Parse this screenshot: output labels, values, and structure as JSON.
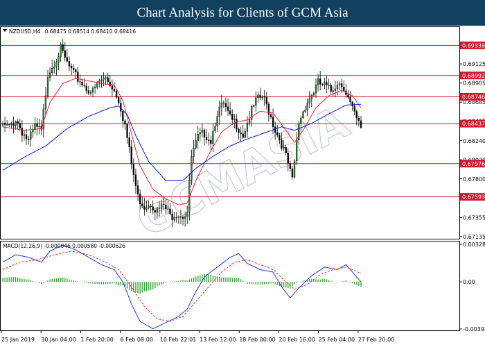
{
  "title": "Chart Analysis for Clients of GCM Asia",
  "price_header": {
    "symbol": "NZDUSD,H4",
    "ohlc": "0.68475 0.68514 0.68410 0.68416"
  },
  "macd_header": "MACD(12,26,9) -0.000046 0.000580 -0.000626",
  "watermark": "GCMASIA",
  "colors": {
    "title_bg": "#12415f",
    "bull": "#2e8b2e",
    "bear": "#000000",
    "ma_fast": "#e8283a",
    "ma_slow": "#1010ee",
    "level": "#cc1a2e",
    "level_label_bg": "#cc1a2e",
    "macd_line": "#1f3bdd",
    "signal_line": "#e0302f",
    "histogram": "#3aa53a"
  },
  "chart_data": [
    {
      "type": "candlestick",
      "symbol": "NZDUSD",
      "timeframe": "H4",
      "ylim": [
        0.6711,
        0.6955
      ],
      "y_ticks": [
        "0.69125",
        "0.68905",
        "0.68685",
        "0.68465",
        "0.68240",
        "0.68020",
        "0.67800",
        "0.67575",
        "0.67355",
        "0.67135"
      ],
      "x_tick_labels": [
        "25 Jan 2019",
        "30 Jan 04:00",
        "1 Feb 20:00",
        "6 Feb 08:00",
        "10 Feb 22:01",
        "13 Feb 12:00",
        "18 Feb 00:00",
        "20 Feb 16:00",
        "25 Feb 04:00",
        "27 Feb 20:00"
      ],
      "levels": [
        {
          "value": 0.69339,
          "label": "0.69339"
        },
        {
          "value": 0.68992,
          "label": "0.68992"
        },
        {
          "value": 0.68746,
          "label": "0.68746"
        },
        {
          "value": 0.68437,
          "label": "0.68437"
        },
        {
          "value": 0.67976,
          "label": "0.67976"
        },
        {
          "value": 0.67593,
          "label": "0.67593"
        }
      ],
      "close_path": [
        [
          0,
          0.6844
        ],
        [
          3,
          0.6842
        ],
        [
          6,
          0.6852
        ],
        [
          9,
          0.6838
        ],
        [
          12,
          0.6826
        ],
        [
          15,
          0.6843
        ],
        [
          18,
          0.6837
        ],
        [
          21,
          0.6905
        ],
        [
          24,
          0.6918
        ],
        [
          27,
          0.6932
        ],
        [
          30,
          0.6916
        ],
        [
          33,
          0.6903
        ],
        [
          36,
          0.6896
        ],
        [
          39,
          0.6888
        ],
        [
          42,
          0.6883
        ],
        [
          45,
          0.6895
        ],
        [
          48,
          0.6899
        ],
        [
          51,
          0.689
        ],
        [
          54,
          0.6875
        ],
        [
          57,
          0.6845
        ],
        [
          60,
          0.68
        ],
        [
          63,
          0.6762
        ],
        [
          66,
          0.6752
        ],
        [
          69,
          0.6756
        ],
        [
          72,
          0.6746
        ],
        [
          75,
          0.6752
        ],
        [
          78,
          0.674
        ],
        [
          81,
          0.6744
        ],
        [
          84,
          0.6741
        ],
        [
          86,
          0.6745
        ],
        [
          88,
          0.6808
        ],
        [
          91,
          0.683
        ],
        [
          94,
          0.6836
        ],
        [
          97,
          0.6828
        ],
        [
          100,
          0.686
        ],
        [
          103,
          0.6868
        ],
        [
          106,
          0.6852
        ],
        [
          109,
          0.6846
        ],
        [
          112,
          0.6834
        ],
        [
          115,
          0.6855
        ],
        [
          118,
          0.6872
        ],
        [
          121,
          0.6878
        ],
        [
          124,
          0.6862
        ],
        [
          127,
          0.684
        ],
        [
          130,
          0.6824
        ],
        [
          133,
          0.68
        ],
        [
          135,
          0.678
        ],
        [
          138,
          0.6848
        ],
        [
          141,
          0.6868
        ],
        [
          144,
          0.688
        ],
        [
          147,
          0.6893
        ],
        [
          150,
          0.689
        ],
        [
          153,
          0.6884
        ],
        [
          156,
          0.6895
        ],
        [
          159,
          0.689
        ],
        [
          162,
          0.6869
        ],
        [
          165,
          0.685
        ],
        [
          167,
          0.6842
        ]
      ],
      "series": [
        {
          "name": "",
          "kind": "ma_fast",
          "values": [
            [
              0,
              0.684
            ],
            [
              10,
              0.6836
            ],
            [
              18,
              0.6838
            ],
            [
              22,
              0.6868
            ],
            [
              28,
              0.689
            ],
            [
              34,
              0.6896
            ],
            [
              40,
              0.6893
            ],
            [
              46,
              0.689
            ],
            [
              52,
              0.6888
            ],
            [
              56,
              0.687
            ],
            [
              60,
              0.6832
            ],
            [
              64,
              0.6795
            ],
            [
              70,
              0.6768
            ],
            [
              76,
              0.6757
            ],
            [
              82,
              0.675
            ],
            [
              86,
              0.6752
            ],
            [
              90,
              0.6778
            ],
            [
              96,
              0.6808
            ],
            [
              102,
              0.6834
            ],
            [
              108,
              0.6845
            ],
            [
              114,
              0.6848
            ],
            [
              120,
              0.6858
            ],
            [
              126,
              0.6856
            ],
            [
              132,
              0.6836
            ],
            [
              136,
              0.6822
            ],
            [
              140,
              0.6836
            ],
            [
              146,
              0.6862
            ],
            [
              152,
              0.6876
            ],
            [
              158,
              0.6882
            ],
            [
              163,
              0.6876
            ],
            [
              167,
              0.6862
            ]
          ]
        },
        {
          "name": "",
          "kind": "ma_slow",
          "values": [
            [
              0,
              0.679
            ],
            [
              10,
              0.6805
            ],
            [
              20,
              0.6818
            ],
            [
              30,
              0.6838
            ],
            [
              40,
              0.6852
            ],
            [
              50,
              0.6862
            ],
            [
              54,
              0.6864
            ],
            [
              58,
              0.6854
            ],
            [
              62,
              0.683
            ],
            [
              68,
              0.68
            ],
            [
              76,
              0.6778
            ],
            [
              84,
              0.6778
            ],
            [
              90,
              0.6792
            ],
            [
              98,
              0.6806
            ],
            [
              106,
              0.6818
            ],
            [
              114,
              0.6826
            ],
            [
              122,
              0.6833
            ],
            [
              130,
              0.684
            ],
            [
              136,
              0.6836
            ],
            [
              144,
              0.6844
            ],
            [
              152,
              0.6855
            ],
            [
              160,
              0.6865
            ],
            [
              167,
              0.6866
            ]
          ]
        }
      ]
    },
    {
      "type": "line",
      "name": "MACD(12,26,9)",
      "ylim": [
        -0.00393,
        0.00328
      ],
      "y_ticks": [
        "0.003288",
        "0.00",
        "-0.00393"
      ],
      "series": [
        {
          "name": "",
          "kind": "macd",
          "values": [
            [
              0,
              0.0016
            ],
            [
              6,
              0.0022
            ],
            [
              12,
              0.002
            ],
            [
              18,
              0.0016
            ],
            [
              22,
              0.0025
            ],
            [
              28,
              0.003
            ],
            [
              34,
              0.0026
            ],
            [
              40,
              0.002
            ],
            [
              46,
              0.0014
            ],
            [
              52,
              0.001
            ],
            [
              56,
              0.0
            ],
            [
              60,
              -0.0018
            ],
            [
              64,
              -0.0032
            ],
            [
              70,
              -0.0038
            ],
            [
              76,
              -0.0033
            ],
            [
              82,
              -0.0028
            ],
            [
              86,
              -0.0022
            ],
            [
              90,
              -0.0008
            ],
            [
              94,
              0.0004
            ],
            [
              100,
              0.0012
            ],
            [
              106,
              0.002
            ],
            [
              110,
              0.0023
            ],
            [
              114,
              0.0015
            ],
            [
              120,
              0.001
            ],
            [
              126,
              0.0008
            ],
            [
              130,
              -0.0004
            ],
            [
              134,
              -0.0013
            ],
            [
              138,
              -0.0005
            ],
            [
              144,
              0.0005
            ],
            [
              150,
              0.0012
            ],
            [
              156,
              0.001
            ],
            [
              160,
              0.0014
            ],
            [
              164,
              0.0006
            ],
            [
              167,
              0.0
            ]
          ]
        },
        {
          "name": "",
          "kind": "signal",
          "values": [
            [
              0,
              0.001
            ],
            [
              8,
              0.0016
            ],
            [
              16,
              0.0018
            ],
            [
              24,
              0.0022
            ],
            [
              32,
              0.0025
            ],
            [
              40,
              0.0022
            ],
            [
              48,
              0.0016
            ],
            [
              54,
              0.001
            ],
            [
              60,
              -0.0004
            ],
            [
              66,
              -0.002
            ],
            [
              72,
              -0.003
            ],
            [
              78,
              -0.0032
            ],
            [
              84,
              -0.0028
            ],
            [
              90,
              -0.0016
            ],
            [
              96,
              -0.0004
            ],
            [
              102,
              0.0008
            ],
            [
              108,
              0.0016
            ],
            [
              114,
              0.0018
            ],
            [
              120,
              0.0014
            ],
            [
              126,
              0.001
            ],
            [
              132,
              0.0
            ],
            [
              136,
              -0.0006
            ],
            [
              142,
              -0.0002
            ],
            [
              148,
              0.0006
            ],
            [
              154,
              0.001
            ],
            [
              160,
              0.0012
            ],
            [
              167,
              0.0007
            ]
          ]
        }
      ]
    }
  ]
}
